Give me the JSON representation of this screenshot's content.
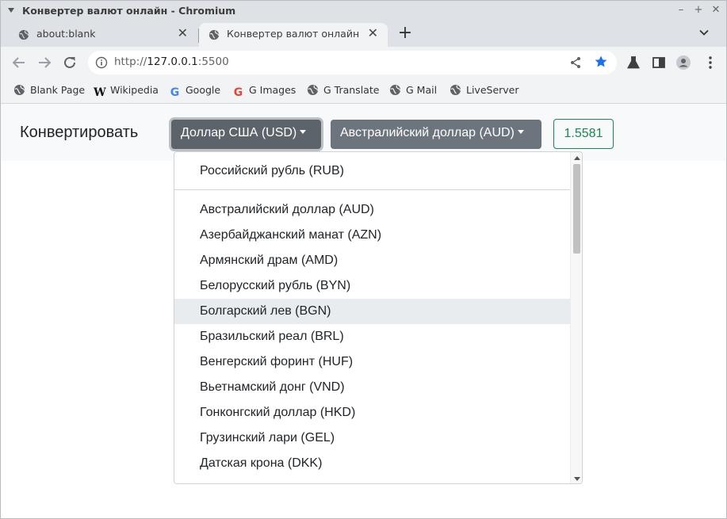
{
  "window": {
    "title": "Конвертер валют онлайн - Chromium",
    "minimize": "–",
    "maximize": "+",
    "close": "✕"
  },
  "tabs": [
    {
      "label": "about:blank",
      "close": "✕"
    },
    {
      "label": "Конвертер валют онлайн",
      "close": "✕"
    }
  ],
  "new_tab": "+",
  "address_bar": {
    "scheme": "http://",
    "host": "127.0.0.1",
    "port": ":5500"
  },
  "bookmarks": [
    {
      "label": "Blank Page",
      "icon": "globe-icon"
    },
    {
      "label": "Wikipedia",
      "icon": "wikipedia-icon",
      "glyph": "W"
    },
    {
      "label": "Google",
      "icon": "google-icon",
      "glyph": "G"
    },
    {
      "label": "G Images",
      "icon": "google-icon",
      "glyph": "G"
    },
    {
      "label": "G Translate",
      "icon": "globe-icon"
    },
    {
      "label": "G Mail",
      "icon": "globe-icon"
    },
    {
      "label": "LiveServer",
      "icon": "globe-icon"
    }
  ],
  "app": {
    "brand": "Конвертировать",
    "from_currency": "Доллар США (USD)",
    "to_currency": "Австралийский доллар (AUD)",
    "rate": "1.5581"
  },
  "dropdown": {
    "pinned": "Российский рубль (RUB)",
    "items": [
      "Австралийский доллар (AUD)",
      "Азербайджанский манат (AZN)",
      "Армянский драм (AMD)",
      "Белорусский рубль (BYN)",
      "Болгарский лев (BGN)",
      "Бразильский реал (BRL)",
      "Венгерский форинт (HUF)",
      "Вьетнамский донг (VND)",
      "Гонконгский доллар (HKD)",
      "Грузинский лари (GEL)",
      "Датская крона (DKK)"
    ],
    "hovered": "Болгарский лев (BGN)"
  },
  "colors": {
    "secondary": "#6c757d",
    "success": "#198754",
    "star": "#1a73e8",
    "hover": "#e9ecef"
  }
}
